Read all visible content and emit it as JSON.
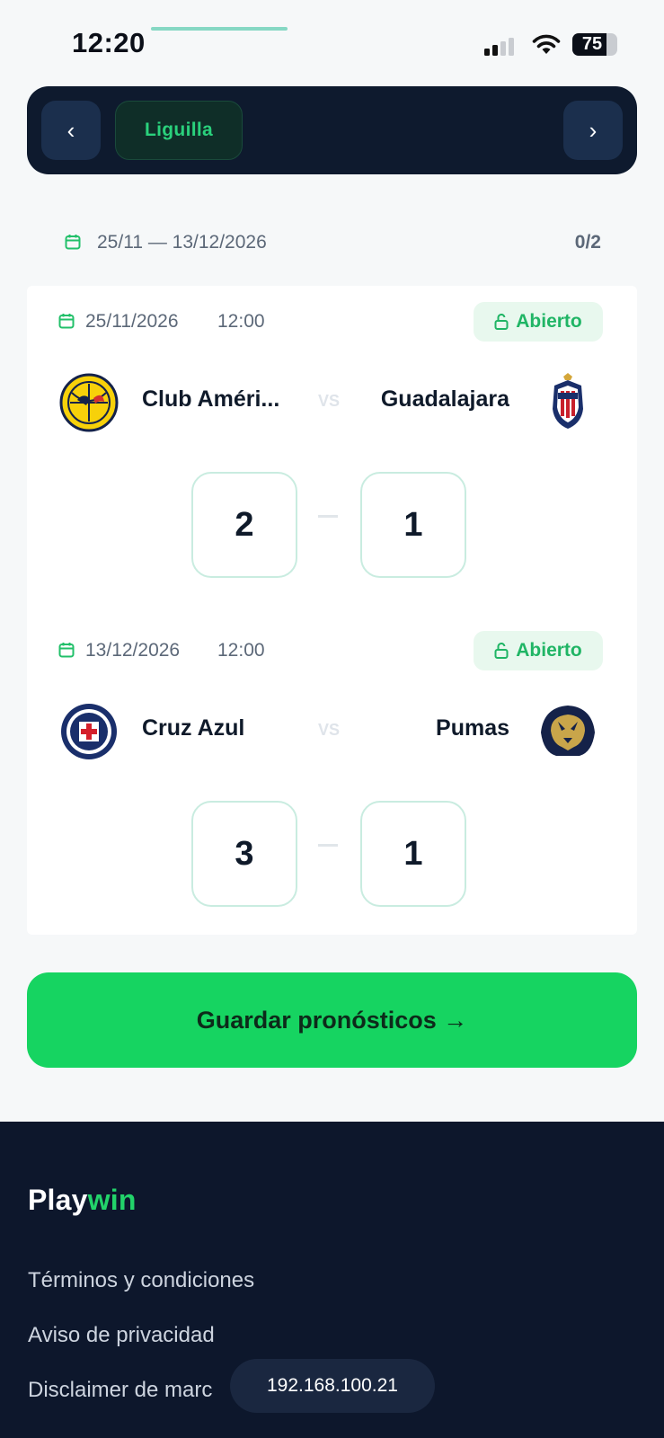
{
  "status_bar": {
    "time": "12:20",
    "battery": "75",
    "battery_level": 0.75
  },
  "round_selector": {
    "prev_icon": "chevron-left-icon",
    "label": "Liguilla",
    "next_icon": "chevron-right-icon"
  },
  "range": {
    "dates": "25/11 — 13/12/2026",
    "progress": "0/2"
  },
  "matches": [
    {
      "date": "25/11/2026",
      "time": "12:00",
      "status": "Abierto",
      "home": {
        "name": "Club Améri...",
        "logo": "club-america-logo"
      },
      "vs": "VS",
      "away": {
        "name": "Guadalajara",
        "logo": "guadalajara-logo"
      },
      "score_home": "2",
      "score_away": "1"
    },
    {
      "date": "13/12/2026",
      "time": "12:00",
      "status": "Abierto",
      "home": {
        "name": "Cruz Azul",
        "logo": "cruz-azul-logo"
      },
      "vs": "VS",
      "away": {
        "name": "Pumas",
        "logo": "pumas-logo"
      },
      "score_home": "3",
      "score_away": "1"
    }
  ],
  "save_button": {
    "label": "Guardar pronósticos →"
  },
  "footer": {
    "brand_main": "Play",
    "brand_accent": "win",
    "links": [
      "Términos y condiciones",
      "Aviso de privacidad",
      "Disclaimer de marc"
    ],
    "ip": "192.168.100.21"
  },
  "colors": {
    "accent": "#16d461",
    "dark": "#0d172c",
    "open_badge": "#20b565"
  }
}
